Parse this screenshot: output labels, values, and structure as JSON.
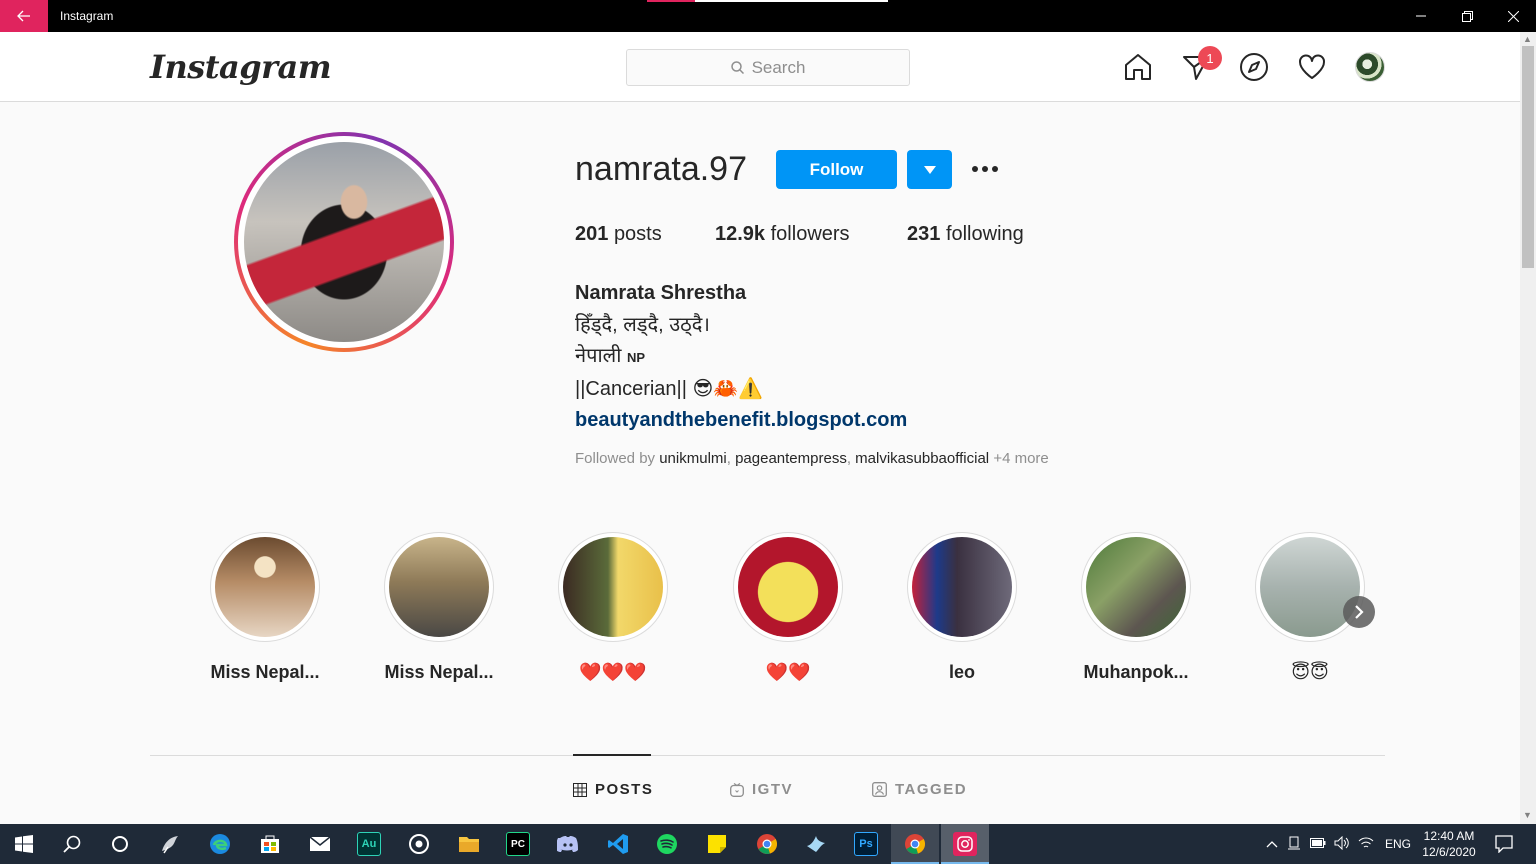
{
  "window": {
    "title": "Instagram"
  },
  "header": {
    "logo": "Instagram",
    "search_placeholder": "Search",
    "notification_count": "1",
    "icons": [
      "home-icon",
      "direct-message-icon",
      "explore-icon",
      "activity-heart-icon",
      "profile-avatar"
    ]
  },
  "profile": {
    "username": "namrata.97",
    "follow_label": "Follow",
    "stats": {
      "posts_count": "201",
      "posts_label": "posts",
      "followers_count": "12.9k",
      "followers_label": "followers",
      "following_count": "231",
      "following_label": "following"
    },
    "bio": {
      "full_name": "Namrata Shrestha",
      "line1": "हिँड्दै, लड्दै, उठ्दै।",
      "line2": "नेपाली",
      "line2_flag": "NP",
      "line3": "||Cancerian|| 😎🦀⚠️",
      "link": "beautyandthebenefit.blogspot.com"
    },
    "followed_by": {
      "prefix": "Followed by",
      "users": [
        "unikmulmi",
        "pageantempress",
        "malvikasubbaofficial"
      ],
      "more": "+4 more"
    }
  },
  "highlights": [
    {
      "label": "Miss Nepal..."
    },
    {
      "label": "Miss Nepal..."
    },
    {
      "label": "❤️❤️❤️"
    },
    {
      "label": "❤️❤️"
    },
    {
      "label": "leo"
    },
    {
      "label": "Muhanpok..."
    },
    {
      "label": "😇😇"
    }
  ],
  "tabs": [
    {
      "label": "POSTS",
      "active": true
    },
    {
      "label": "IGTV",
      "active": false
    },
    {
      "label": "TAGGED",
      "active": false
    }
  ],
  "taskbar": {
    "apps": [
      "windows-start",
      "search",
      "cortana",
      "app-bird",
      "edge",
      "store",
      "mail",
      "audition",
      "app-circle",
      "file-explorer",
      "pycharm",
      "discord",
      "vscode",
      "spotify",
      "sticky-notes",
      "chrome",
      "app-bird2",
      "photoshop",
      "chrome-2",
      "instagram"
    ],
    "audition_label": "Au",
    "pycharm_label": "PC",
    "photoshop_label": "Ps",
    "language": "ENG",
    "time": "12:40 AM",
    "date": "12/6/2020"
  },
  "colors": {
    "accent_blue": "#0095f6",
    "link_blue": "#00376b",
    "badge_red": "#ed4956",
    "titlebar_back": "#e0245e"
  }
}
